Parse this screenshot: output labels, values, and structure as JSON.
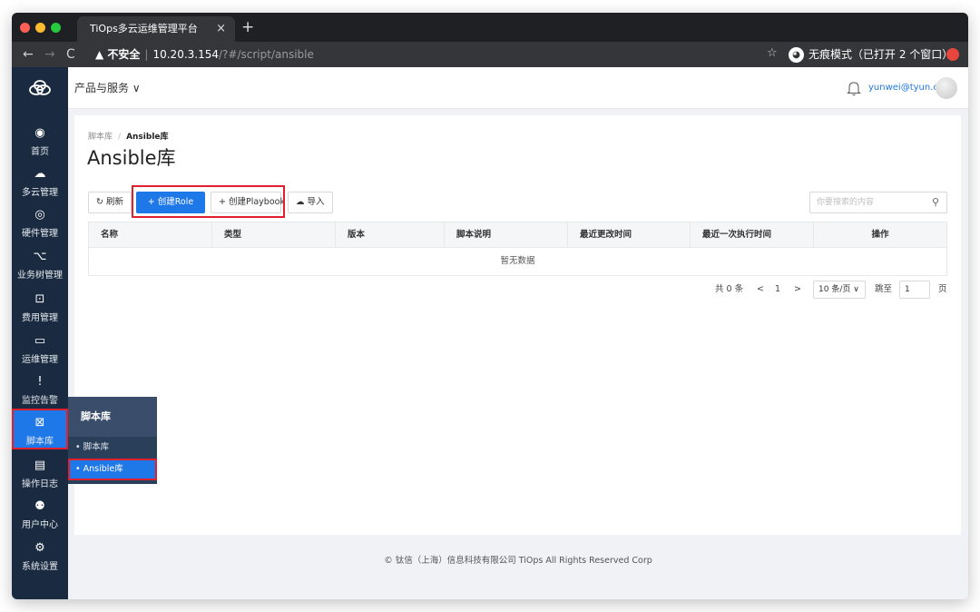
{
  "browser": {
    "tab_title": "TiOps多云运维管理平台",
    "tab_close": "×",
    "new_tab": "+",
    "security_label": "▲ 不安全",
    "url_host": "10.20.3.154",
    "url_path": "/?#/script/ansible",
    "incognito_label": "无痕模式（已打开 2 个窗口）"
  },
  "sidebar": {
    "items": [
      {
        "label": "首页",
        "icon": "◉"
      },
      {
        "label": "多云管理",
        "icon": "☁"
      },
      {
        "label": "硬件管理",
        "icon": "◎"
      },
      {
        "label": "业务树管理",
        "icon": "⌥"
      },
      {
        "label": "费用管理",
        "icon": "⊡"
      },
      {
        "label": "运维管理",
        "icon": "▭"
      },
      {
        "label": "监控告警",
        "icon": "!"
      },
      {
        "label": "脚本库",
        "icon": "⊠"
      },
      {
        "label": "操作日志",
        "icon": "▤"
      },
      {
        "label": "用户中心",
        "icon": "⚉"
      },
      {
        "label": "系统设置",
        "icon": "⚙"
      }
    ]
  },
  "topbar": {
    "products_label": "产品与服务 ∨",
    "user_email": "yunwei@tyun.cn"
  },
  "page": {
    "breadcrumb_parent": "脚本库",
    "breadcrumb_sep": "/",
    "breadcrumb_current": "Ansible库",
    "title": "Ansible库"
  },
  "toolbar": {
    "refresh_label": "↻ 刷新",
    "create_role_label": "+ 创建Role",
    "create_playbook_label": "+ 创建Playbook",
    "import_label": "☁ 导入",
    "search_placeholder": "你要搜索的内容"
  },
  "table": {
    "columns": [
      "名称",
      "类型",
      "版本",
      "脚本说明",
      "最近更改时间",
      "最近一次执行时间",
      "操作"
    ],
    "empty_text": "暂无数据"
  },
  "pagination": {
    "total": "共 0 条",
    "prev": "<",
    "current_page": "1",
    "next": ">",
    "page_size": "10 条/页 ∨",
    "jump_label": "跳至",
    "jump_value": "1",
    "page_suffix": "页"
  },
  "submenu": {
    "header": "脚本库",
    "items": [
      "• 脚本库",
      "• Ansible库"
    ]
  },
  "footer": {
    "copyright": "© 钛信（上海）信息科技有限公司 TiOps All Rights Reserved Corp"
  },
  "colors": {
    "sidebar_bg": "#1a2b41",
    "primary": "#1f78e8",
    "highlight_border": "#e0202e"
  }
}
